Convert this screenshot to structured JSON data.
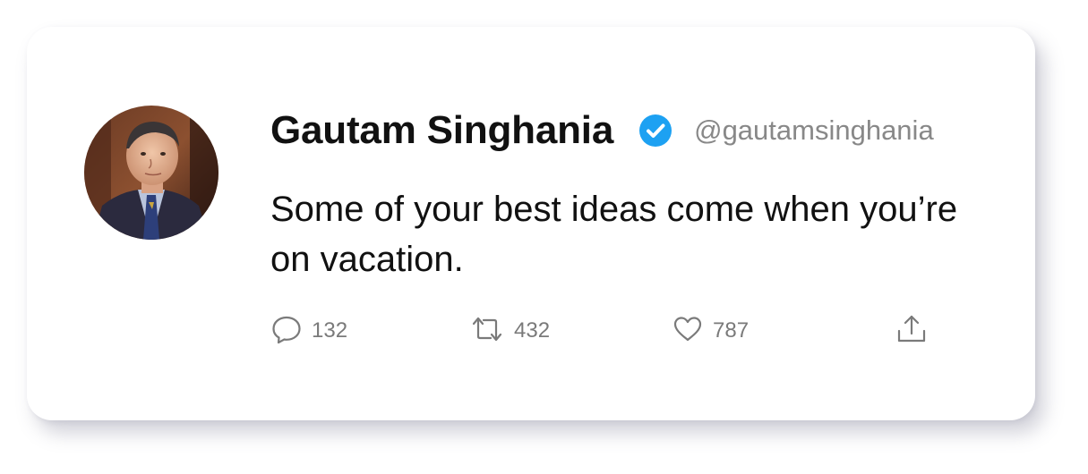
{
  "tweet": {
    "author_name": "Gautam Singhania",
    "handle": "@gautamsinghania",
    "verified": true,
    "text": "Some of your best ideas come when you’re on vacation.",
    "accent_color": "#1DA1F2"
  },
  "actions": {
    "reply": {
      "icon": "reply-icon",
      "count": "132"
    },
    "retweet": {
      "icon": "retweet-icon",
      "count": "432"
    },
    "like": {
      "icon": "heart-icon",
      "count": "787"
    },
    "share": {
      "icon": "share-icon"
    }
  }
}
